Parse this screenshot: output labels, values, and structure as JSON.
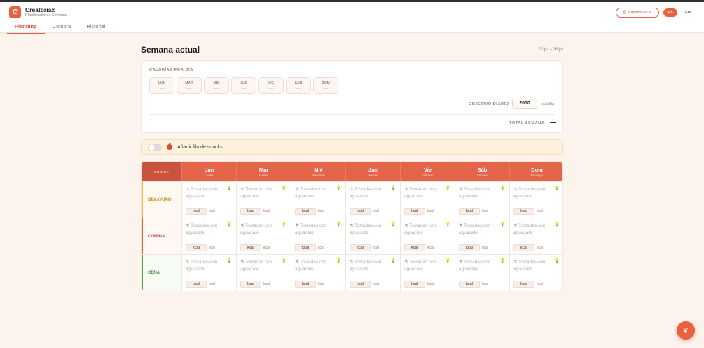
{
  "app": {
    "logo_letter": "C",
    "title": "Creatoriax",
    "subtitle": "Planificador de Comidas"
  },
  "tabs": [
    {
      "label": "Planning",
      "active": true
    },
    {
      "label": "Compra",
      "active": false
    },
    {
      "label": "Historial",
      "active": false
    }
  ],
  "header": {
    "export_label": "Exportar PDF",
    "lang_es": "ES",
    "lang_en": "EN"
  },
  "week": {
    "title": "Semana actual",
    "range": "20 jul – 26 jul"
  },
  "calories": {
    "label": "CALORÍAS POR DÍA",
    "days": [
      {
        "abbr": "LUN",
        "value": "—"
      },
      {
        "abbr": "MAR",
        "value": "—"
      },
      {
        "abbr": "MIÉ",
        "value": "—"
      },
      {
        "abbr": "JUE",
        "value": "—"
      },
      {
        "abbr": "VIE",
        "value": "—"
      },
      {
        "abbr": "SÁB",
        "value": "—"
      },
      {
        "abbr": "DOM",
        "value": "—"
      }
    ],
    "objective_label": "OBJETIVO DIARIO",
    "objective_value": "2000",
    "objective_unit": "kcal/día",
    "total_label": "TOTAL SEMANA",
    "total_value": "—"
  },
  "snacks": {
    "label": "Añadir fila de snacks",
    "enabled": false
  },
  "grid": {
    "meal_header": "COMIDA",
    "days": [
      {
        "name": "Lun",
        "full": "Lunes"
      },
      {
        "name": "Mar",
        "full": "Martes"
      },
      {
        "name": "Mié",
        "full": "Miércoles"
      },
      {
        "name": "Jue",
        "full": "Jueves"
      },
      {
        "name": "Vie",
        "full": "Viernes"
      },
      {
        "name": "Sáb",
        "full": "Sábado"
      },
      {
        "name": "Dom",
        "full": "Domingo"
      }
    ],
    "meals": [
      {
        "label": "DESAYUNO"
      },
      {
        "label": "COMIDA"
      },
      {
        "label": "CENA"
      }
    ],
    "cell_placeholder": "Tostadas con aguacate",
    "kcal_placeholder": "kcal",
    "kcal_unit": "kcal"
  },
  "colors": {
    "accent": "#e8623d",
    "breakfast": "#f0b43c",
    "lunch": "#e4644a",
    "dinner": "#5aa356"
  }
}
